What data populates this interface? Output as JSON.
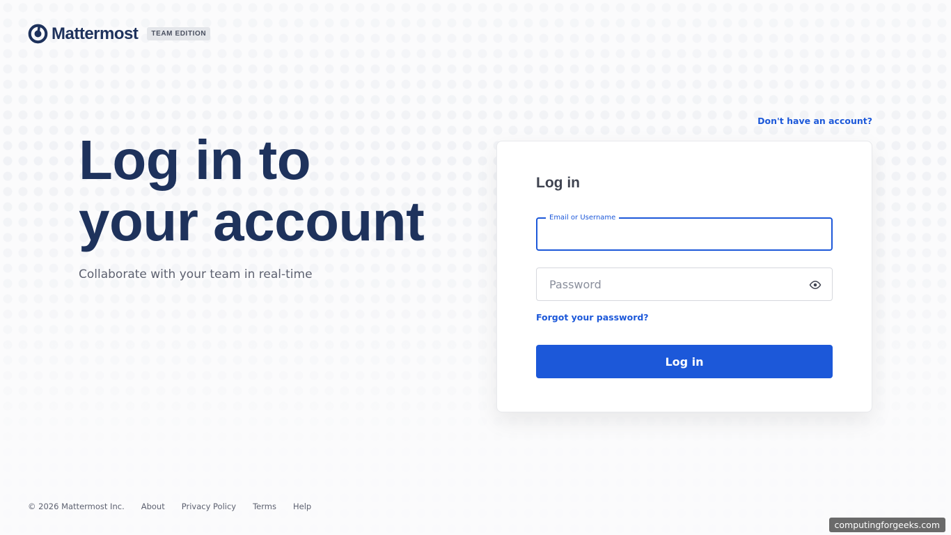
{
  "brand": {
    "name": "Mattermost",
    "edition": "TEAM EDITION",
    "color": "#1e325c"
  },
  "hero": {
    "title_line1": "Log in to",
    "title_line2": "your account",
    "subtitle": "Collaborate with your team in real-time"
  },
  "signup_link": "Don't have an account?",
  "login_card": {
    "title": "Log in",
    "email_label": "Email or Username",
    "email_value": "",
    "password_placeholder": "Password",
    "forgot_link": "Forgot your password?",
    "submit_label": "Log in",
    "password_toggle_icon": "eye-icon"
  },
  "footer": {
    "copyright": "© 2026 Mattermost Inc.",
    "links": [
      "About",
      "Privacy Policy",
      "Terms",
      "Help"
    ]
  },
  "watermark": "computingforgeeks.com",
  "colors": {
    "accent": "#1c58d9",
    "text": "#3f4350",
    "muted": "#5d6170"
  }
}
